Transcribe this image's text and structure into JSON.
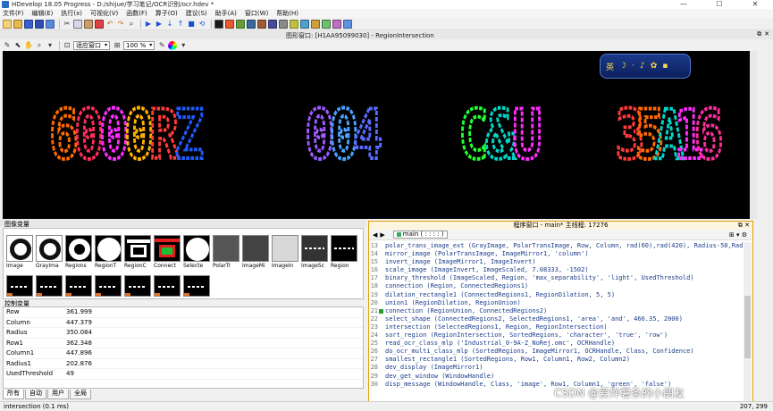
{
  "window": {
    "title": "HDevelop 18.05 Progress - D:/shijue/学习笔记/OCR识别/ocr.hdev *",
    "controls": [
      "—",
      "☐",
      "✕"
    ]
  },
  "menu": [
    "文件(F)",
    "编辑(E)",
    "执行(x)",
    "可视化(V)",
    "函数(F)",
    "算子(O)",
    "建议(S)",
    "助手(A)",
    "窗口(W)",
    "帮助(H)"
  ],
  "graphics_window": {
    "title": "图形窗口: [H1AA95099030] - RegionIntersection",
    "zoom_combo": "适应窗口",
    "percent_combo": "100 %",
    "ocr_groups": [
      {
        "text": "6000RZ",
        "colors": [
          "#ff6a00",
          "#ff2d5a",
          "#ff2dff",
          "#ffb300",
          "#ff3b3b",
          "#1e5bff"
        ]
      },
      {
        "text": "004",
        "colors": [
          "#9a5bff",
          "#4aa3ff",
          "#5a6bff"
        ]
      },
      {
        "text": "C&U",
        "colors": [
          "#22ff33",
          "#00d6c8",
          "#ff2dff"
        ]
      },
      {
        "text": "35A16",
        "colors": [
          "#ff3b3b",
          "#ff6a00",
          "#00d6c8",
          "#ff2dff",
          "#ff2d9a"
        ]
      }
    ],
    "ime": [
      "英",
      "☽",
      "·",
      "♪",
      "✿",
      "▪"
    ]
  },
  "image_vars": {
    "header": "图像变量",
    "thumbnails": [
      "Image",
      "GrayIma",
      "Regions",
      "RegionT",
      "RegionC",
      "Connect",
      "Selecte",
      "PolarTr",
      "ImageMi",
      "ImageIn",
      "ImageSc",
      "Region"
    ]
  },
  "control_vars": {
    "header": "控制变量",
    "rows": [
      {
        "name": "Row",
        "value": "361.999"
      },
      {
        "name": "Column",
        "value": "447.379"
      },
      {
        "name": "Radius",
        "value": "350.084"
      },
      {
        "name": "Row1",
        "value": "362.348"
      },
      {
        "name": "Column1",
        "value": "447.896"
      },
      {
        "name": "Radius1",
        "value": "202.876"
      },
      {
        "name": "UsedThreshold",
        "value": "49"
      }
    ]
  },
  "tabs": [
    "所有",
    "自动",
    "用户",
    "全局"
  ],
  "status": {
    "left": "intersection (0.1 ms)",
    "right": "207, 299"
  },
  "program_window": {
    "title": "程序窗口 - main* 主线程: 17276",
    "procedure": "main ( : : : : )",
    "pc_line": 21,
    "lines": [
      {
        "n": 13,
        "code": "polar_trans_image_ext (GrayImage, PolarTransImage, Row, Column, rad(60),rad(420), Radius-50,Radius1"
      },
      {
        "n": 14,
        "code": "mirror_image (PolarTransImage, ImageMirror1, 'column')"
      },
      {
        "n": 15,
        "code": "invert_image (ImageMirror1, ImageInvert)"
      },
      {
        "n": 16,
        "code": "scale_image (ImageInvert, ImageScaled, 7.08333, -1502)"
      },
      {
        "n": 17,
        "code": "binary_threshold (ImageScaled, Region, 'max_separability', 'light', UsedThreshold)"
      },
      {
        "n": 18,
        "code": "connection (Region, ConnectedRegions1)"
      },
      {
        "n": 19,
        "code": "dilation_rectangle1 (ConnectedRegions1, RegionDilation, 5, 5)"
      },
      {
        "n": 20,
        "code": "union1 (RegionDilation, RegionUnion)"
      },
      {
        "n": 21,
        "code": "connection (RegionUnion, ConnectedRegions2)"
      },
      {
        "n": 22,
        "code": "select_shape (ConnectedRegions2, SelectedRegions1, 'area', 'and', 466.35, 2000)"
      },
      {
        "n": 23,
        "code": "intersection (SelectedRegions1, Region, RegionIntersection)"
      },
      {
        "n": 24,
        "code": "sort_region (RegionIntersection, SortedRegions, 'character', 'true', 'row')"
      },
      {
        "n": 25,
        "code": "read_ocr_class_mlp ('Industrial_0-9A-Z_NoRej.omc', OCRHandle)"
      },
      {
        "n": 26,
        "code": "do_ocr_multi_class_mlp (SortedRegions, ImageMirror1, OCRHandle, Class, Confidence)"
      },
      {
        "n": 27,
        "code": "smallest_rectangle1 (SortedRegions, Row1, Column1, Row2, Column2)"
      },
      {
        "n": 28,
        "code": "dev_display (ImageMirror1)"
      },
      {
        "n": 29,
        "code": "dev_get_window (WindowHandle)"
      },
      {
        "n": 30,
        "code": "disp_message (WindowHandle, Class, 'image', Row1, Column1, 'green', 'false')"
      }
    ]
  },
  "watermark": "CSDN @爱炸薯条的小朋友",
  "colors": {
    "canvas": "#000000",
    "program_border": "#e0a000",
    "code_text": "#1a3e8a",
    "pc_marker": "#2a9a2a"
  }
}
